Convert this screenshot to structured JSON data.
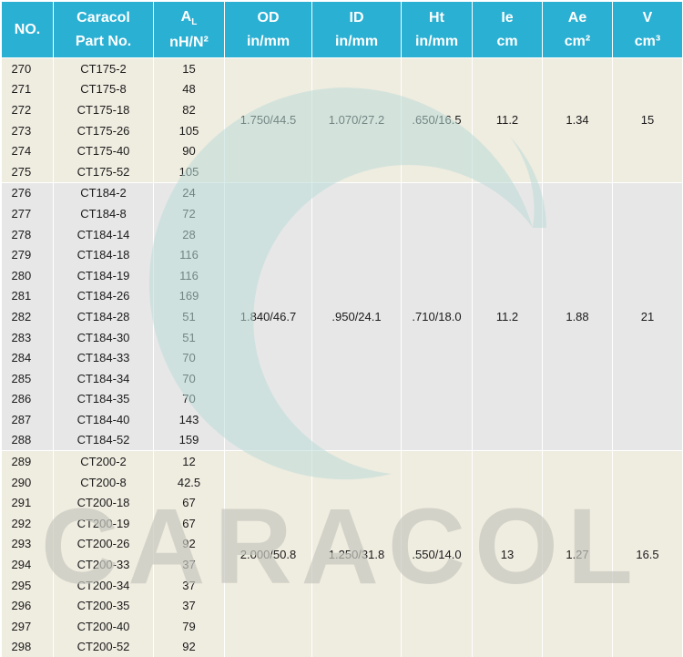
{
  "headers": [
    {
      "line1": "NO.",
      "line2": ""
    },
    {
      "line1": "Caracol",
      "line2": "Part No."
    },
    {
      "line1": "A",
      "sub": "L",
      "line2": "nH/N²"
    },
    {
      "line1": "OD",
      "line2": "in/mm"
    },
    {
      "line1": "ID",
      "line2": "in/mm"
    },
    {
      "line1": "Ht",
      "line2": "in/mm"
    },
    {
      "line1": "Ie",
      "line2": "cm"
    },
    {
      "line1": "Ae",
      "line2": "cm²"
    },
    {
      "line1": "V",
      "line2": "cm³"
    }
  ],
  "watermark": {
    "text": "CARACOL",
    "color": "#c8c8c0",
    "swirl_color": "#bcdcd8"
  },
  "colors": {
    "header": "#2ab0d3",
    "group_a": "#efece0",
    "group_b": "#e7e7e7"
  },
  "groups": [
    {
      "od": "1.750/44.5",
      "id": "1.070/27.2",
      "ht": ".650/16.5",
      "ie": "11.2",
      "ae": "1.34",
      "v": "15",
      "rows": [
        {
          "no": "270",
          "part": "CT175-2",
          "al": "15"
        },
        {
          "no": "271",
          "part": "CT175-8",
          "al": "48"
        },
        {
          "no": "272",
          "part": "CT175-18",
          "al": "82"
        },
        {
          "no": "273",
          "part": "CT175-26",
          "al": "105"
        },
        {
          "no": "274",
          "part": "CT175-40",
          "al": "90"
        },
        {
          "no": "275",
          "part": "CT175-52",
          "al": "105"
        }
      ]
    },
    {
      "od": "1.840/46.7",
      "id": ".950/24.1",
      "ht": ".710/18.0",
      "ie": "11.2",
      "ae": "1.88",
      "v": "21",
      "rows": [
        {
          "no": "276",
          "part": "CT184-2",
          "al": "24"
        },
        {
          "no": "277",
          "part": "CT184-8",
          "al": "72"
        },
        {
          "no": "278",
          "part": "CT184-14",
          "al": "28"
        },
        {
          "no": "279",
          "part": "CT184-18",
          "al": "116"
        },
        {
          "no": "280",
          "part": "CT184-19",
          "al": "116"
        },
        {
          "no": "281",
          "part": "CT184-26",
          "al": "169"
        },
        {
          "no": "282",
          "part": "CT184-28",
          "al": "51"
        },
        {
          "no": "283",
          "part": "CT184-30",
          "al": "51"
        },
        {
          "no": "284",
          "part": "CT184-33",
          "al": "70"
        },
        {
          "no": "285",
          "part": "CT184-34",
          "al": "70"
        },
        {
          "no": "286",
          "part": "CT184-35",
          "al": "70"
        },
        {
          "no": "287",
          "part": "CT184-40",
          "al": "143"
        },
        {
          "no": "288",
          "part": "CT184-52",
          "al": "159"
        }
      ]
    },
    {
      "od": "2.000/50.8",
      "id": "1.250/31.8",
      "ht": ".550/14.0",
      "ie": "13",
      "ae": "1.27",
      "v": "16.5",
      "rows": [
        {
          "no": "289",
          "part": "CT200-2",
          "al": "12"
        },
        {
          "no": "290",
          "part": "CT200-8",
          "al": "42.5"
        },
        {
          "no": "291",
          "part": "CT200-18",
          "al": "67"
        },
        {
          "no": "292",
          "part": "CT200-19",
          "al": "67"
        },
        {
          "no": "293",
          "part": "CT200-26",
          "al": "92"
        },
        {
          "no": "294",
          "part": "CT200-33",
          "al": "37"
        },
        {
          "no": "295",
          "part": "CT200-34",
          "al": "37"
        },
        {
          "no": "296",
          "part": "CT200-35",
          "al": "37"
        },
        {
          "no": "297",
          "part": "CT200-40",
          "al": "79"
        },
        {
          "no": "298",
          "part": "CT200-52",
          "al": "92"
        }
      ]
    }
  ]
}
